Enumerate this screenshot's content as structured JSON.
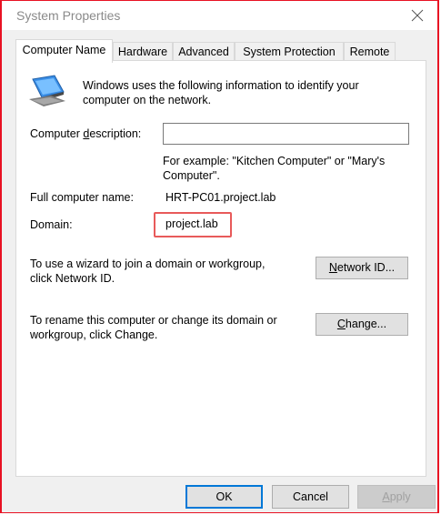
{
  "window": {
    "title": "System Properties"
  },
  "tabs": [
    {
      "label": "Computer Name",
      "active": true
    },
    {
      "label": "Hardware",
      "active": false
    },
    {
      "label": "Advanced",
      "active": false
    },
    {
      "label": "System Protection",
      "active": false
    },
    {
      "label": "Remote",
      "active": false
    }
  ],
  "panel": {
    "intro_line1": "Windows uses the following information to identify your",
    "intro_line2": "computer on the network.",
    "description_label_pre": "Computer ",
    "description_label_ul": "d",
    "description_label_post": "escription:",
    "description_value": "",
    "example_line1": "For example: \"Kitchen Computer\" or \"Mary's",
    "example_line2": "Computer\".",
    "full_name_label": "Full computer name:",
    "full_name_value": "HRT-PC01.project.lab",
    "domain_label": "Domain:",
    "domain_value": "project.lab",
    "wizard_line1": "To use a wizard to join a domain or workgroup,",
    "wizard_line2": "click Network ID.",
    "network_id_ul": "N",
    "network_id_rest": "etwork ID...",
    "rename_line1": "To rename this computer or change its domain or",
    "rename_line2": "workgroup, click Change.",
    "change_ul": "C",
    "change_rest": "hange..."
  },
  "footer": {
    "ok": "OK",
    "cancel": "Cancel",
    "apply_ul": "A",
    "apply_rest": "pply"
  },
  "colors": {
    "accent": "#0078d7",
    "highlight_border": "#e81123"
  },
  "icons": {
    "computer": "computer-icon",
    "close": "close-icon"
  }
}
